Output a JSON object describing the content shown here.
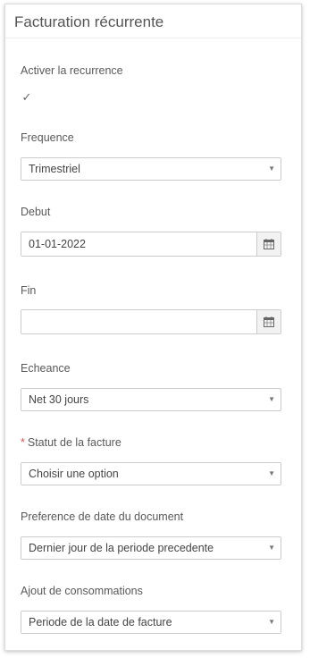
{
  "panel": {
    "title": "Facturation récurrente"
  },
  "fields": {
    "activer": {
      "label": "Activer la recurrence",
      "checked": true,
      "check_glyph": "✓"
    },
    "frequence": {
      "label": "Frequence",
      "value": "Trimestriel"
    },
    "debut": {
      "label": "Debut",
      "value": "01-01-2022"
    },
    "fin": {
      "label": "Fin",
      "value": ""
    },
    "echeance": {
      "label": "Echeance",
      "value": "Net 30 jours"
    },
    "statut": {
      "label": "Statut de la facture",
      "required_mark": "*",
      "value": "Choisir une option"
    },
    "preference": {
      "label": "Preference de date du document",
      "value": "Dernier jour de la periode precedente"
    },
    "ajout": {
      "label": "Ajout de consommations",
      "value": "Periode de la date de facture"
    }
  },
  "icons": {
    "caret": "▼",
    "calendar": "calendar-icon"
  },
  "colors": {
    "required": "#d9534f",
    "border": "#cccccc",
    "addon_bg": "#f2f2f2"
  }
}
